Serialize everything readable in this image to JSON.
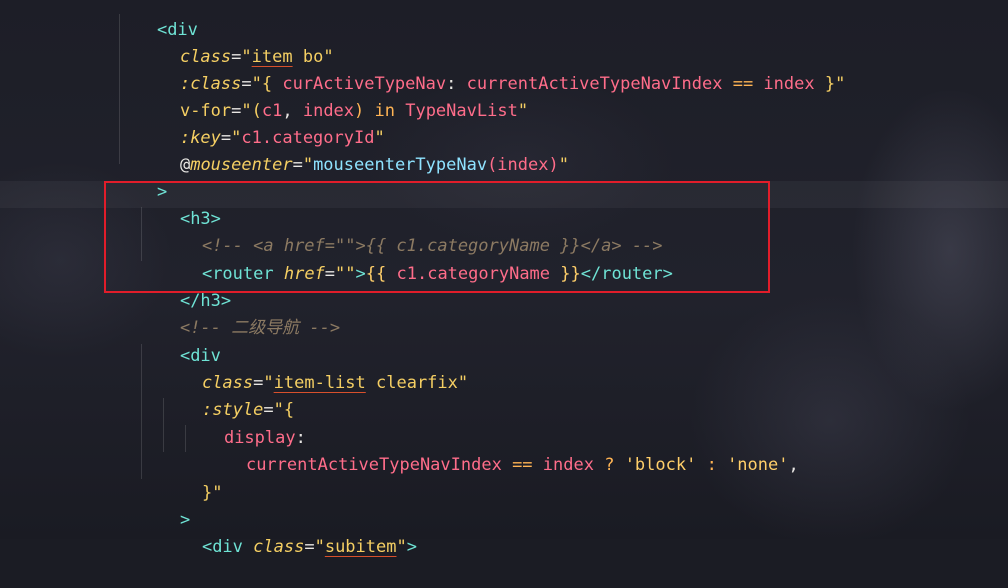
{
  "code": {
    "l0_open": "<div",
    "l1_attr": "class",
    "l1_eq": "=",
    "l1_q1": "\"",
    "l1_v1": "item",
    "l1_v2": " bo",
    "l1_q2": "\"",
    "l2_attr": ":class",
    "l2_eq": "=",
    "l2_q1": "\"{ ",
    "l2_key": "curActiveTypeNav",
    "l2_colon": ": ",
    "l2_expr1": "currentActiveTypeNavIndex",
    "l2_op": " == ",
    "l2_expr2": "index",
    "l2_q2": " }\"",
    "l3_attr": "v-for",
    "l3_eq": "=",
    "l3_q1": "\"(",
    "l3_v1": "c1",
    "l3_comma": ", ",
    "l3_v2": "index",
    "l3_in": ") in ",
    "l3_list": "TypeNavList",
    "l3_q2": "\"",
    "l4_attr": ":key",
    "l4_eq": "=",
    "l4_q1": "\"",
    "l4_v": "c1.categoryId",
    "l4_q2": "\"",
    "l5_at": "@",
    "l5_attr": "mouseenter",
    "l5_eq": "=",
    "l5_q1": "\"",
    "l5_fn": "mouseenterTypeNav",
    "l5_args": "(index)",
    "l5_q2": "\"",
    "l6_close": ">",
    "l7_h3": "<h3>",
    "l8_comment": "<!-- <a href=\"\">{{ c1.categoryName }}</a> -->",
    "l9_open": "<router",
    "l9_attr": " href",
    "l9_eq": "=",
    "l9_str": "\"\"",
    "l9_gt": ">",
    "l9_mus1": "{{ ",
    "l9_var": "c1.categoryName",
    "l9_mus2": " }}",
    "l9_close": "</router>",
    "l10_h3": "</h3>",
    "l11_comment": "<!-- 二级导航 -->",
    "l12_open": "<div",
    "l13_attr": "class",
    "l13_eq": "=",
    "l13_q1": "\"",
    "l13_v1": "item-list",
    "l13_v2": " clearfix",
    "l13_q2": "\"",
    "l14_attr": ":style",
    "l14_eq": "=",
    "l14_q1": "\"{",
    "l15_prop": "display",
    "l15_colon": ":",
    "l16_expr1": "currentActiveTypeNavIndex",
    "l16_op": " == ",
    "l16_expr2": "index",
    "l16_tern": " ? ",
    "l16_s1": "'block'",
    "l16_colon": " : ",
    "l16_s2": "'none'",
    "l16_comma": ",",
    "l17_end": "}\"",
    "l18_close": ">",
    "l19_open": "<div",
    "l19_attr": " class",
    "l19_eq": "=",
    "l19_q1": "\"",
    "l19_v": "subitem",
    "l19_q2": "\"",
    "l19_gt": ">"
  },
  "colors": {
    "highlight_box": "#e11d2a",
    "tag": "#6fe3d5",
    "attribute": "#f5cf63",
    "variable": "#ff6d8a",
    "comment": "#8c7a62"
  }
}
